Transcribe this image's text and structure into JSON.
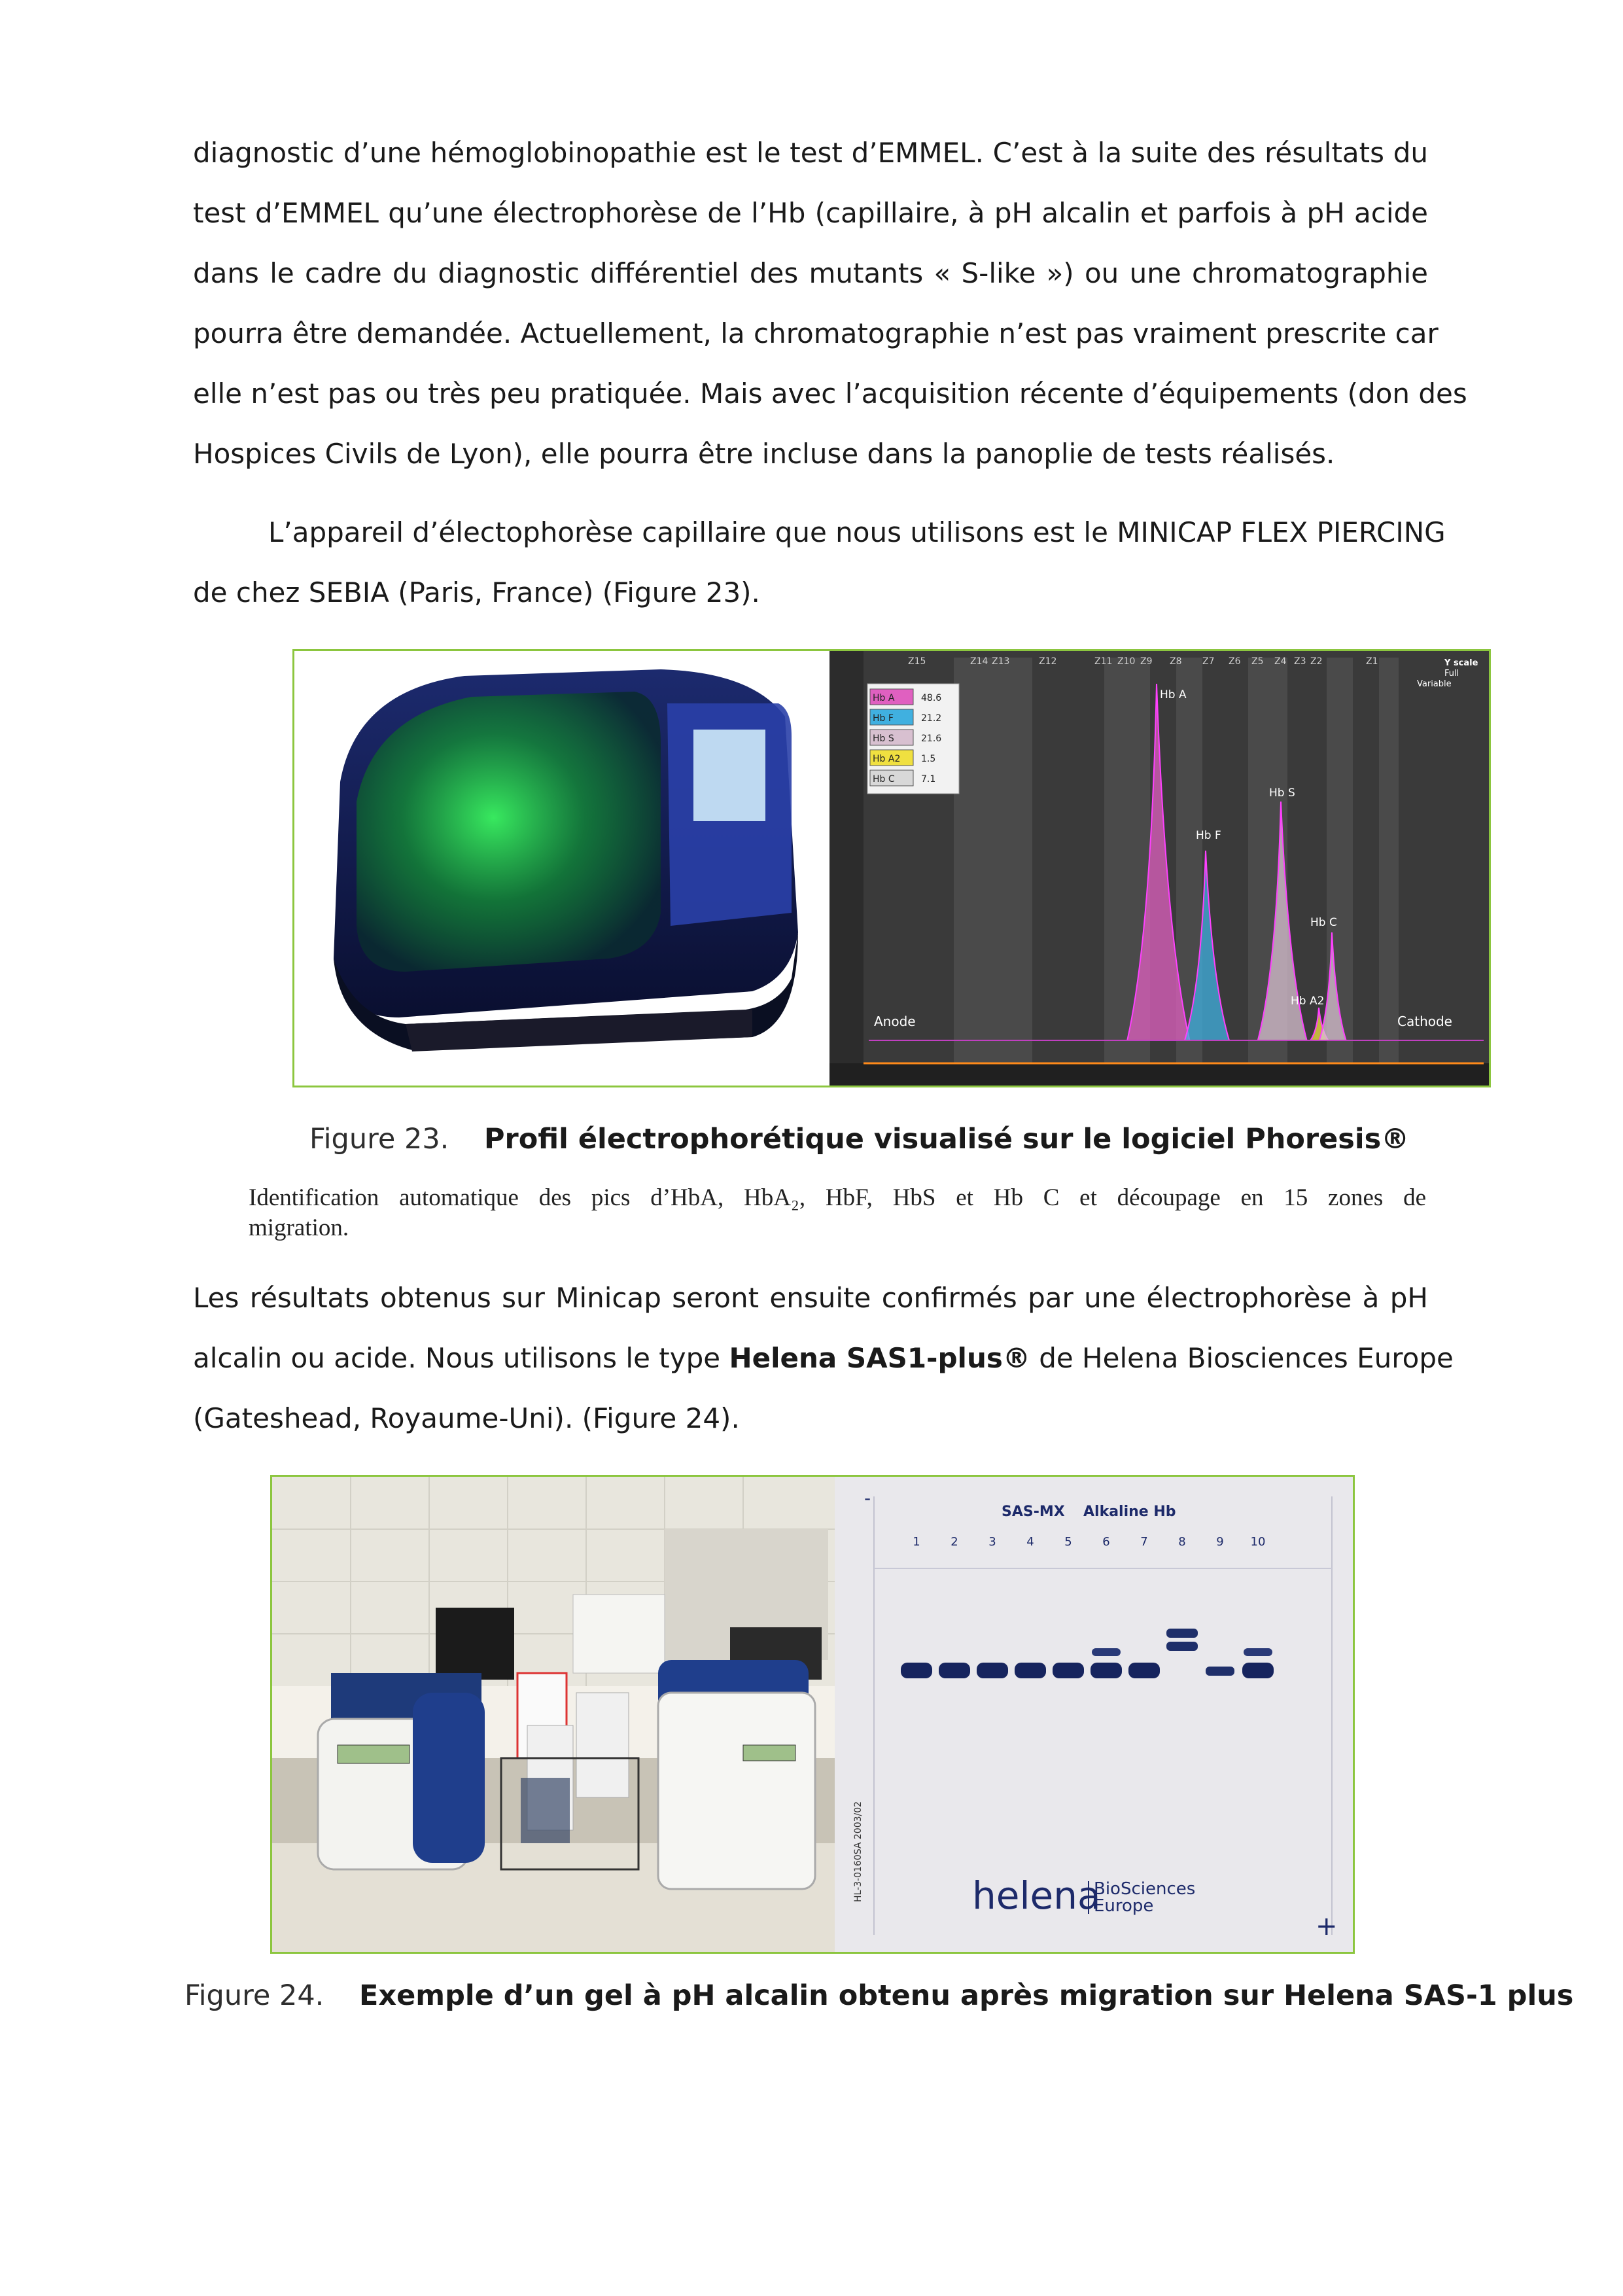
{
  "paragraph1": {
    "lines": [
      "diagnostic d’une hémoglobinopathie est le test d’EMMEL. C’est à la suite des résultats du",
      "test d’EMMEL qu’une électrophorèse de l’Hb (capillaire, à pH alcalin et parfois à pH acide",
      "dans le cadre du diagnostic différentiel des mutants « S-like ») ou une chromatographie",
      "pourra être demandée. Actuellement, la chromatographie n’est pas vraiment prescrite car",
      "elle n’est pas ou très peu pratiquée. Mais avec l’acquisition récente d’équipements (don des",
      "Hospices Civils de Lyon), elle pourra être incluse dans la panoplie de tests réalisés."
    ]
  },
  "paragraph2": {
    "lines": [
      "L’appareil d’électophorèse capillaire que nous utilisons est le MINICAP FLEX PIERCING",
      "de chez SEBIA (Paris, France) (Figure 23)."
    ]
  },
  "figure23": {
    "number": "Figure 23.",
    "title": "Profil électrophorétique visualisé sur le logiciel Phoresis®",
    "subcaption_lines": [
      "Identification automatique des pics d’HbA, HbA₂, HbF, HbS et Hb C et découpage en 15 zones de",
      "migration."
    ],
    "chart": {
      "zones": [
        "Z15",
        "Z14",
        "Z13",
        "Z12",
        "Z11",
        "Z10",
        "Z9",
        "Z8",
        "Z7",
        "Z6",
        "Z5",
        "Z4",
        "Z3",
        "Z2",
        "Z1"
      ],
      "peak_labels": [
        "Hb A",
        "Hb F",
        "Hb S",
        "Hb C",
        "Hb A2"
      ],
      "anode": "Anode",
      "cathode": "Cathode",
      "yscale_title": "Y scale",
      "yscale_full": "Full",
      "yscale_variable": "Variable",
      "table": [
        {
          "name": "Hb A",
          "value": "48.6",
          "color": "#e060c0"
        },
        {
          "name": "Hb F",
          "value": "21.2",
          "color": "#40b0e0"
        },
        {
          "name": "Hb S",
          "value": "21.6",
          "color": "#d8c0d0"
        },
        {
          "name": "Hb A2",
          "value": "1.5",
          "color": "#f0e040"
        },
        {
          "name": "Hb C",
          "value": "7.1",
          "color": "#d8d8d8"
        }
      ]
    }
  },
  "paragraph3": {
    "line1": "Les résultats obtenus sur Minicap seront ensuite confirmés par une électrophorèse à pH",
    "line2_before": "alcalin ou acide. Nous utilisons le type ",
    "line2_bold": "Helena SAS1-plus®",
    "line2_after": " de Helena Biosciences Europe",
    "line3": "(Gateshead, Royaume-Uni).  (Figure 24)."
  },
  "figure24": {
    "number": "Figure 24.",
    "title": "Exemple d’un gel à pH alcalin obtenu après migration sur Helena SAS-1 plus",
    "gel": {
      "title_sas": "SAS-MX",
      "title_rest": "Alkaline Hb",
      "lanes": [
        "1",
        "2",
        "3",
        "4",
        "5",
        "6",
        "7",
        "8",
        "9",
        "10"
      ],
      "side_code": "HL-3-0160SA 2003/02",
      "brand": "helena",
      "brand_line1": "BioSciences",
      "brand_line2": "Europe",
      "plus_mark": "+",
      "minus_mark": "-"
    }
  }
}
